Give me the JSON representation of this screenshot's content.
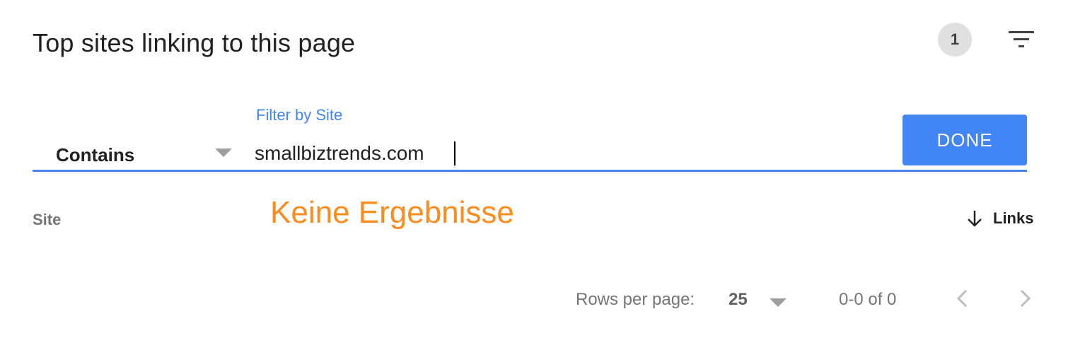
{
  "header": {
    "title": "Top sites linking to this page",
    "filter_count": "1",
    "filter_icon": "filter-list-icon"
  },
  "filter": {
    "operator": "Contains",
    "field_label": "Filter by Site",
    "value": "smallbiztrends.com",
    "done_label": "DONE"
  },
  "table": {
    "columns": {
      "site": "Site",
      "links": "Links"
    },
    "sort_icon": "arrow-down-icon",
    "empty_message": "Keine Ergebnisse"
  },
  "pagination": {
    "rows_label": "Rows per page:",
    "rows_value": "25",
    "range": "0-0 of 0",
    "prev_icon": "chevron-left-icon",
    "next_icon": "chevron-right-icon"
  },
  "colors": {
    "accent": "#4285f4",
    "empty_message": "#fb8c1e",
    "muted_text": "#757575"
  }
}
